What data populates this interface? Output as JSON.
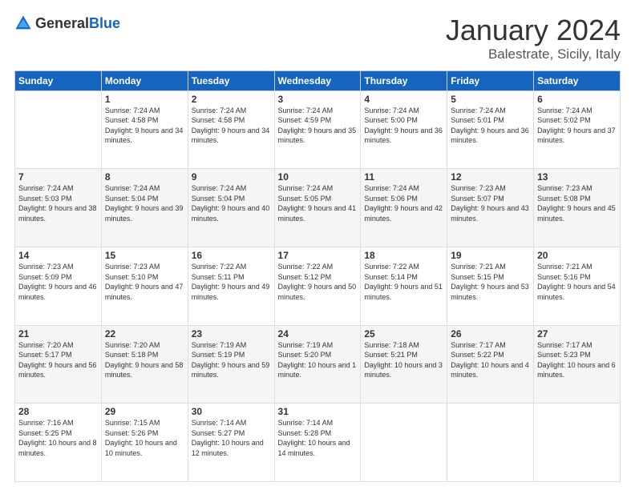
{
  "logo": {
    "general": "General",
    "blue": "Blue"
  },
  "header": {
    "month": "January 2024",
    "location": "Balestrate, Sicily, Italy"
  },
  "weekdays": [
    "Sunday",
    "Monday",
    "Tuesday",
    "Wednesday",
    "Thursday",
    "Friday",
    "Saturday"
  ],
  "weeks": [
    [
      {
        "day": "",
        "sunrise": "",
        "sunset": "",
        "daylight": ""
      },
      {
        "day": "1",
        "sunrise": "Sunrise: 7:24 AM",
        "sunset": "Sunset: 4:58 PM",
        "daylight": "Daylight: 9 hours and 34 minutes."
      },
      {
        "day": "2",
        "sunrise": "Sunrise: 7:24 AM",
        "sunset": "Sunset: 4:58 PM",
        "daylight": "Daylight: 9 hours and 34 minutes."
      },
      {
        "day": "3",
        "sunrise": "Sunrise: 7:24 AM",
        "sunset": "Sunset: 4:59 PM",
        "daylight": "Daylight: 9 hours and 35 minutes."
      },
      {
        "day": "4",
        "sunrise": "Sunrise: 7:24 AM",
        "sunset": "Sunset: 5:00 PM",
        "daylight": "Daylight: 9 hours and 36 minutes."
      },
      {
        "day": "5",
        "sunrise": "Sunrise: 7:24 AM",
        "sunset": "Sunset: 5:01 PM",
        "daylight": "Daylight: 9 hours and 36 minutes."
      },
      {
        "day": "6",
        "sunrise": "Sunrise: 7:24 AM",
        "sunset": "Sunset: 5:02 PM",
        "daylight": "Daylight: 9 hours and 37 minutes."
      }
    ],
    [
      {
        "day": "7",
        "sunrise": "Sunrise: 7:24 AM",
        "sunset": "Sunset: 5:03 PM",
        "daylight": "Daylight: 9 hours and 38 minutes."
      },
      {
        "day": "8",
        "sunrise": "Sunrise: 7:24 AM",
        "sunset": "Sunset: 5:04 PM",
        "daylight": "Daylight: 9 hours and 39 minutes."
      },
      {
        "day": "9",
        "sunrise": "Sunrise: 7:24 AM",
        "sunset": "Sunset: 5:04 PM",
        "daylight": "Daylight: 9 hours and 40 minutes."
      },
      {
        "day": "10",
        "sunrise": "Sunrise: 7:24 AM",
        "sunset": "Sunset: 5:05 PM",
        "daylight": "Daylight: 9 hours and 41 minutes."
      },
      {
        "day": "11",
        "sunrise": "Sunrise: 7:24 AM",
        "sunset": "Sunset: 5:06 PM",
        "daylight": "Daylight: 9 hours and 42 minutes."
      },
      {
        "day": "12",
        "sunrise": "Sunrise: 7:23 AM",
        "sunset": "Sunset: 5:07 PM",
        "daylight": "Daylight: 9 hours and 43 minutes."
      },
      {
        "day": "13",
        "sunrise": "Sunrise: 7:23 AM",
        "sunset": "Sunset: 5:08 PM",
        "daylight": "Daylight: 9 hours and 45 minutes."
      }
    ],
    [
      {
        "day": "14",
        "sunrise": "Sunrise: 7:23 AM",
        "sunset": "Sunset: 5:09 PM",
        "daylight": "Daylight: 9 hours and 46 minutes."
      },
      {
        "day": "15",
        "sunrise": "Sunrise: 7:23 AM",
        "sunset": "Sunset: 5:10 PM",
        "daylight": "Daylight: 9 hours and 47 minutes."
      },
      {
        "day": "16",
        "sunrise": "Sunrise: 7:22 AM",
        "sunset": "Sunset: 5:11 PM",
        "daylight": "Daylight: 9 hours and 49 minutes."
      },
      {
        "day": "17",
        "sunrise": "Sunrise: 7:22 AM",
        "sunset": "Sunset: 5:12 PM",
        "daylight": "Daylight: 9 hours and 50 minutes."
      },
      {
        "day": "18",
        "sunrise": "Sunrise: 7:22 AM",
        "sunset": "Sunset: 5:14 PM",
        "daylight": "Daylight: 9 hours and 51 minutes."
      },
      {
        "day": "19",
        "sunrise": "Sunrise: 7:21 AM",
        "sunset": "Sunset: 5:15 PM",
        "daylight": "Daylight: 9 hours and 53 minutes."
      },
      {
        "day": "20",
        "sunrise": "Sunrise: 7:21 AM",
        "sunset": "Sunset: 5:16 PM",
        "daylight": "Daylight: 9 hours and 54 minutes."
      }
    ],
    [
      {
        "day": "21",
        "sunrise": "Sunrise: 7:20 AM",
        "sunset": "Sunset: 5:17 PM",
        "daylight": "Daylight: 9 hours and 56 minutes."
      },
      {
        "day": "22",
        "sunrise": "Sunrise: 7:20 AM",
        "sunset": "Sunset: 5:18 PM",
        "daylight": "Daylight: 9 hours and 58 minutes."
      },
      {
        "day": "23",
        "sunrise": "Sunrise: 7:19 AM",
        "sunset": "Sunset: 5:19 PM",
        "daylight": "Daylight: 9 hours and 59 minutes."
      },
      {
        "day": "24",
        "sunrise": "Sunrise: 7:19 AM",
        "sunset": "Sunset: 5:20 PM",
        "daylight": "Daylight: 10 hours and 1 minute."
      },
      {
        "day": "25",
        "sunrise": "Sunrise: 7:18 AM",
        "sunset": "Sunset: 5:21 PM",
        "daylight": "Daylight: 10 hours and 3 minutes."
      },
      {
        "day": "26",
        "sunrise": "Sunrise: 7:17 AM",
        "sunset": "Sunset: 5:22 PM",
        "daylight": "Daylight: 10 hours and 4 minutes."
      },
      {
        "day": "27",
        "sunrise": "Sunrise: 7:17 AM",
        "sunset": "Sunset: 5:23 PM",
        "daylight": "Daylight: 10 hours and 6 minutes."
      }
    ],
    [
      {
        "day": "28",
        "sunrise": "Sunrise: 7:16 AM",
        "sunset": "Sunset: 5:25 PM",
        "daylight": "Daylight: 10 hours and 8 minutes."
      },
      {
        "day": "29",
        "sunrise": "Sunrise: 7:15 AM",
        "sunset": "Sunset: 5:26 PM",
        "daylight": "Daylight: 10 hours and 10 minutes."
      },
      {
        "day": "30",
        "sunrise": "Sunrise: 7:14 AM",
        "sunset": "Sunset: 5:27 PM",
        "daylight": "Daylight: 10 hours and 12 minutes."
      },
      {
        "day": "31",
        "sunrise": "Sunrise: 7:14 AM",
        "sunset": "Sunset: 5:28 PM",
        "daylight": "Daylight: 10 hours and 14 minutes."
      },
      {
        "day": "",
        "sunrise": "",
        "sunset": "",
        "daylight": ""
      },
      {
        "day": "",
        "sunrise": "",
        "sunset": "",
        "daylight": ""
      },
      {
        "day": "",
        "sunrise": "",
        "sunset": "",
        "daylight": ""
      }
    ]
  ]
}
